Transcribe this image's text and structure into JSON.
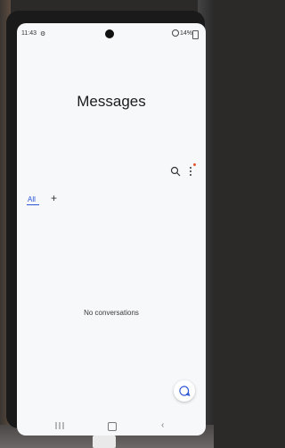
{
  "status_bar": {
    "time": "11:43",
    "battery": "14%"
  },
  "header": {
    "title": "Messages"
  },
  "toolbar": {
    "search_icon": "search-icon",
    "more_icon": "more-options-icon",
    "badge_color": "#e8542c"
  },
  "tabs": [
    {
      "label": "All",
      "active": true
    }
  ],
  "add_tab_icon": "+",
  "empty_state": {
    "text": "No conversations"
  },
  "fab": {
    "icon": "new-message-icon"
  },
  "colors": {
    "accent": "#2b54d6",
    "background": "#f7f8fa"
  },
  "nav_bar": {
    "back_glyph": "‹"
  }
}
